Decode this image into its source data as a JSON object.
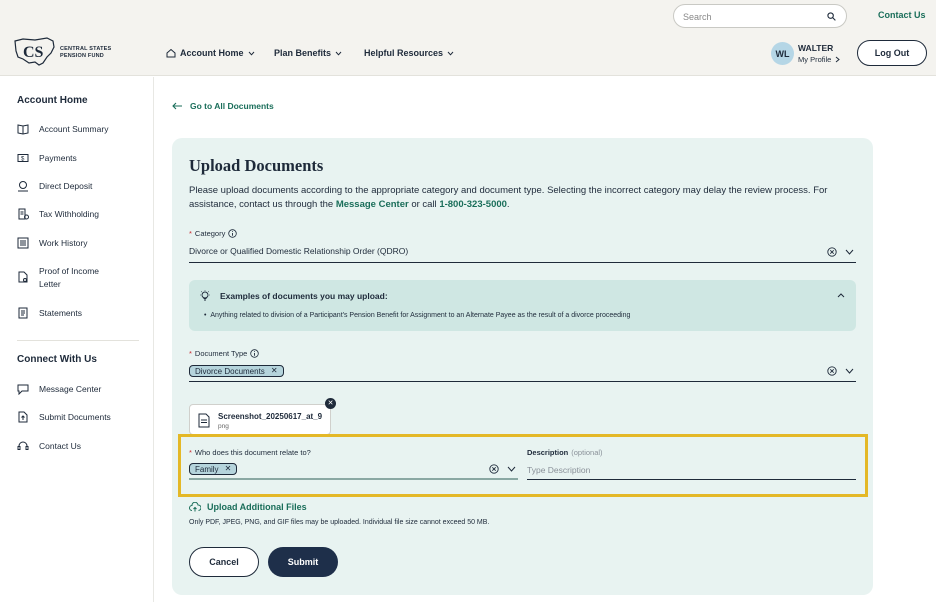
{
  "header": {
    "search_placeholder": "Search",
    "contact_label": "Contact Us",
    "logo_text_line1": "CENTRAL STATES",
    "logo_text_line2": "PENSION FUND",
    "nav": [
      {
        "label": "Account Home",
        "icon": "home-icon"
      },
      {
        "label": "Plan Benefits"
      },
      {
        "label": "Helpful Resources"
      }
    ],
    "user": {
      "initials": "WL",
      "name": "WALTER",
      "profile_label": "My Profile"
    },
    "logout_label": "Log Out"
  },
  "sidebar": {
    "section1_title": "Account Home",
    "section1_items": [
      {
        "label": "Account Summary",
        "icon": "book-icon"
      },
      {
        "label": "Payments",
        "icon": "dollar-icon"
      },
      {
        "label": "Direct Deposit",
        "icon": "bank-icon"
      },
      {
        "label": "Tax Withholding",
        "icon": "tax-icon"
      },
      {
        "label": "Work History",
        "icon": "list-icon"
      },
      {
        "label": "Proof of Income Letter",
        "icon": "document-icon"
      },
      {
        "label": "Statements",
        "icon": "statements-icon"
      }
    ],
    "section2_title": "Connect With Us",
    "section2_items": [
      {
        "label": "Message Center",
        "icon": "message-icon"
      },
      {
        "label": "Submit Documents",
        "icon": "upload-icon"
      },
      {
        "label": "Contact Us",
        "icon": "headset-icon"
      }
    ]
  },
  "main": {
    "back_link": "Go to All Documents",
    "title": "Upload Documents",
    "intro_text_1": "Please upload documents according to the appropriate category and document type. Selecting the incorrect category may delay the review process. For assistance, contact us through the ",
    "intro_link_1": "Message Center",
    "intro_text_2": " or call ",
    "intro_link_2": "1-800-323-5000",
    "intro_text_3": ".",
    "category": {
      "required_mark": "*",
      "label": "Category",
      "value": "Divorce or Qualified Domestic Relationship Order (QDRO)"
    },
    "examples": {
      "title": "Examples of documents you may upload:",
      "items": [
        "Anything related to division of a Participant's Pension Benefit for Assignment to an Alternate Payee as the result of a divorce proceeding"
      ]
    },
    "document_type": {
      "required_mark": "*",
      "label": "Document Type",
      "chip": "Divorce Documents"
    },
    "file": {
      "name": "Screenshot_20250617_at_9",
      "ext": "png"
    },
    "relates_to": {
      "required_mark": "*",
      "label": "Who does this document relate to?",
      "chip": "Family"
    },
    "description": {
      "label": "Description",
      "optional": "(optional)",
      "placeholder": "Type Description"
    },
    "upload_more_label": "Upload Additional Files",
    "upload_note": "Only PDF, JPEG, PNG, and GIF files may be uploaded. Individual file size cannot exceed 50 MB.",
    "cancel_label": "Cancel",
    "submit_label": "Submit"
  },
  "colors": {
    "accent": "#1a6e5a",
    "highlight": "#e4b827",
    "card_bg": "#e8f3f1",
    "primary_button": "#1e2f4a"
  }
}
